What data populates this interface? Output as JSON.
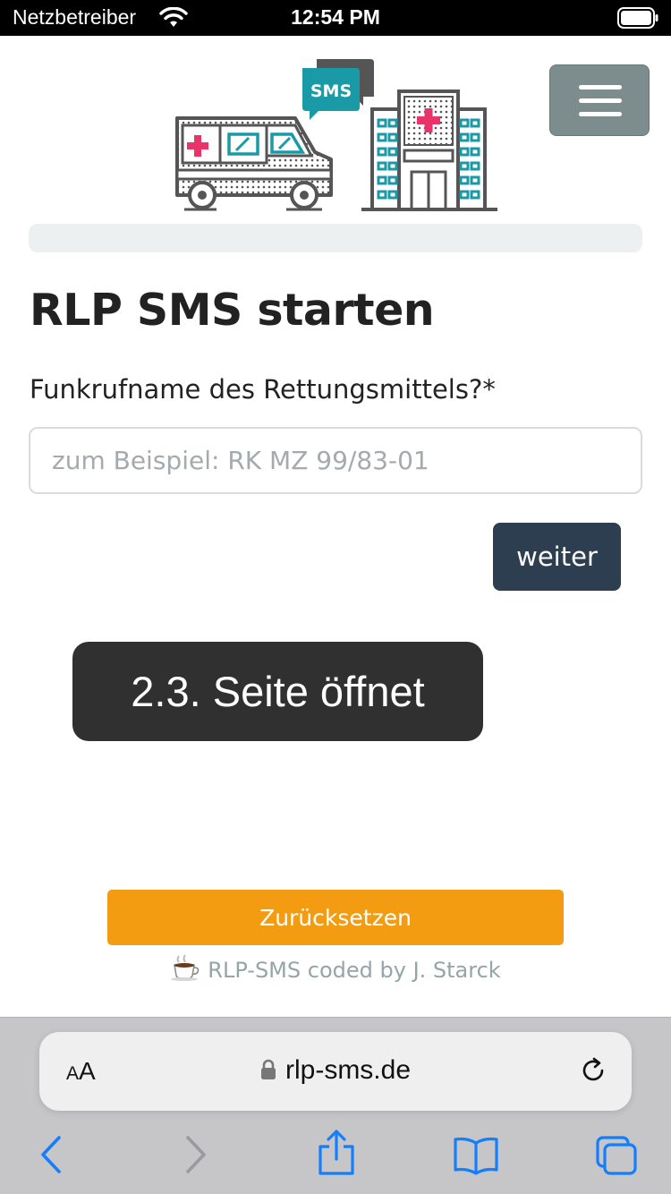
{
  "status_bar": {
    "carrier": "Netzbetreiber",
    "time": "12:54 PM"
  },
  "header": {
    "logo_badge": "SMS",
    "progress": 0
  },
  "main": {
    "title": "RLP SMS starten",
    "field_label": "Funkrufname des Rettungsmittels?*",
    "field_value": "",
    "field_placeholder": "zum Beispiel: RK MZ 99/83-01",
    "next_label": "weiter"
  },
  "toast": {
    "text": "2.3. Seite öffnet"
  },
  "footer": {
    "reset_label": "Zurücksetzen",
    "credit": "RLP-SMS coded by J. Starck"
  },
  "browser": {
    "text_size_label_small": "A",
    "text_size_label_large": "A",
    "url": "rlp-sms.de"
  },
  "colors": {
    "primary_dark": "#2c3e50",
    "menu_button": "#7d8c8c",
    "reset_orange": "#f39c12",
    "teal": "#1a9aa6",
    "red_cross": "#e8336b",
    "ios_blue": "#147efb"
  }
}
